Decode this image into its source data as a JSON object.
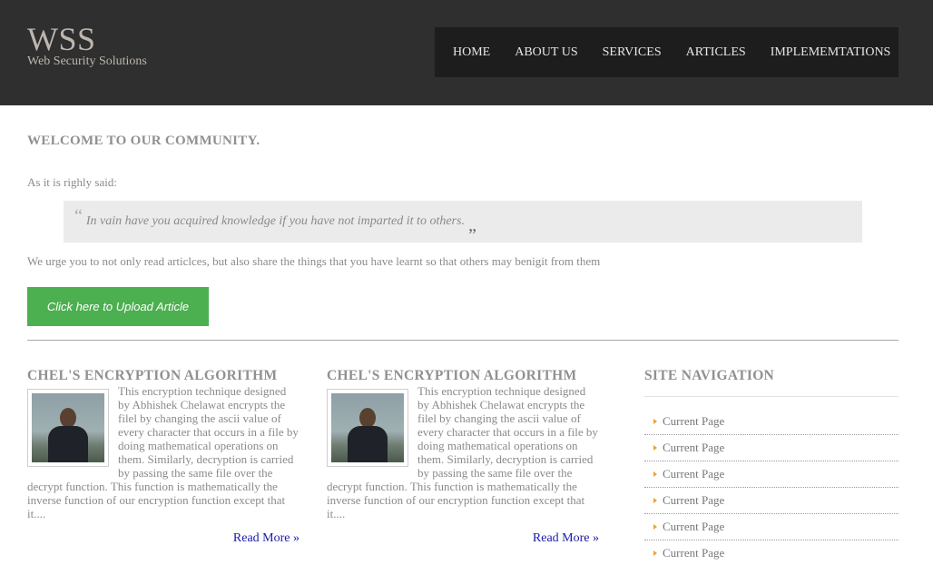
{
  "header": {
    "logo": "WSS",
    "tagline": "Web Security Solutions",
    "nav": [
      "HOME",
      "ABOUT US",
      "SERVICES",
      "ARTICLES",
      "IMPLEMEMTATIONS"
    ]
  },
  "main": {
    "welcome": "WELCOME TO OUR COMMUNITY.",
    "intro": "As it is righly said:",
    "quote": "In vain have you acquired knowledge if you have not imparted it to others.",
    "urge": "We urge you to not only read articlces, but also share the things that you have learnt so that others may benigit from them",
    "upload_button": "Click here to Upload Article"
  },
  "articles": [
    {
      "title": "CHEL'S ENCRYPTION ALGORITHM",
      "text": "This encryption technique designed by Abhishek Chelawat encrypts the filel by changing the ascii value of every character that occurs in a file by doing mathematical operations on them. Similarly, decryption is carried by passing the same file over the decrypt function. This function is mathematically the inverse function of our encryption function except that it....",
      "read_more": "Read More »"
    },
    {
      "title": "CHEL'S ENCRYPTION ALGORITHM",
      "text": "This encryption technique designed by Abhishek Chelawat encrypts the filel by changing the ascii value of every character that occurs in a file by doing mathematical operations on them. Similarly, decryption is carried by passing the same file over the decrypt function. This function is mathematically the inverse function of our encryption function except that it....",
      "read_more": "Read More »"
    }
  ],
  "sidebar": {
    "title": "SITE NAVIGATION",
    "items": [
      "Current Page",
      "Current Page",
      "Current Page",
      "Current Page",
      "Current Page",
      "Current Page"
    ]
  },
  "colors": {
    "header_bg": "#2f2f2f",
    "nav_bg": "#1d1d1d",
    "button_green": "#4caf50",
    "link_blue": "#1a1aa8",
    "arrow_orange": "#f0a030"
  }
}
